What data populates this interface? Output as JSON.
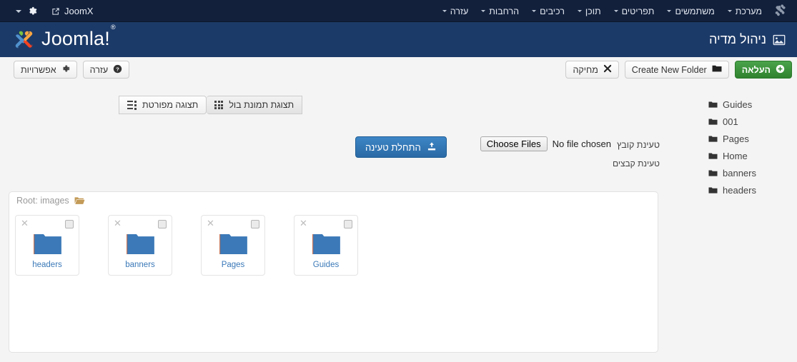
{
  "topbar": {
    "caret_icon": "caret-down-icon",
    "gear_icon": "gear-icon",
    "site_link_icon": "external-link-icon",
    "site_name": "JoomX",
    "brand_icon": "joomla-mark-icon",
    "menu": [
      {
        "label": "מערכת",
        "icon": "chevron-down-icon"
      },
      {
        "label": "משתמשים",
        "icon": "chevron-down-icon"
      },
      {
        "label": "תפריטים",
        "icon": "chevron-down-icon"
      },
      {
        "label": "תוכן",
        "icon": "chevron-down-icon"
      },
      {
        "label": "רכיבים",
        "icon": "chevron-down-icon"
      },
      {
        "label": "הרחבות",
        "icon": "chevron-down-icon"
      },
      {
        "label": "עזרה",
        "icon": "chevron-down-icon"
      }
    ]
  },
  "header": {
    "logo_icon": "joomla-logo-icon",
    "logo_text": "Joomla!",
    "logo_trademark": "®",
    "page_title": "ניהול מדיה",
    "page_title_icon": "image-icon"
  },
  "toolbar": {
    "options_label": "אפשרויות",
    "options_icon": "gear-icon",
    "help_label": "עזרה",
    "help_icon": "question-circle-icon",
    "delete_label": "מחיקה",
    "delete_icon": "close-x-icon",
    "create_folder_label": "Create New Folder",
    "create_folder_icon": "folder-icon",
    "upload_label": "העלאה",
    "upload_icon": "plus-circle-icon",
    "upload_button_color": "#2f822f"
  },
  "view_switch": {
    "thumbnail_label": "תצוגת תמונת בול",
    "thumbnail_icon": "grid-view-icon",
    "detail_label": "תצוגה מפורטת",
    "detail_icon": "list-view-icon",
    "active": "תצוגת תמונת בול"
  },
  "upload": {
    "file_label": "טעינת קובץ",
    "files_label": "טעינת קבצים",
    "choose_files_button": "Choose Files",
    "no_file_text": "No file chosen",
    "start_upload_label": "התחלת טעינה",
    "start_upload_icon": "upload-icon",
    "start_upload_color": "#2a6aa5"
  },
  "tree": {
    "items": [
      {
        "label": "Guides",
        "level": 1,
        "icon": "folder-icon"
      },
      {
        "label": "001",
        "level": 2,
        "icon": "folder-icon"
      },
      {
        "label": "Pages",
        "level": 1,
        "icon": "folder-icon"
      },
      {
        "label": "Home",
        "level": 2,
        "icon": "folder-icon"
      },
      {
        "label": "banners",
        "level": 1,
        "icon": "folder-icon"
      },
      {
        "label": "headers",
        "level": 1,
        "icon": "folder-icon"
      }
    ]
  },
  "panel": {
    "root_label": "Root: images",
    "root_icon": "open-folder-icon",
    "folder_color": "#3b79b8",
    "items": [
      {
        "name": "headers",
        "type": "folder",
        "delete_icon": "close-x-icon",
        "checkbox": false
      },
      {
        "name": "banners",
        "type": "folder",
        "delete_icon": "close-x-icon",
        "checkbox": false
      },
      {
        "name": "Pages",
        "type": "folder",
        "delete_icon": "close-x-icon",
        "checkbox": false
      },
      {
        "name": "Guides",
        "type": "folder",
        "delete_icon": "close-x-icon",
        "checkbox": false
      }
    ]
  }
}
